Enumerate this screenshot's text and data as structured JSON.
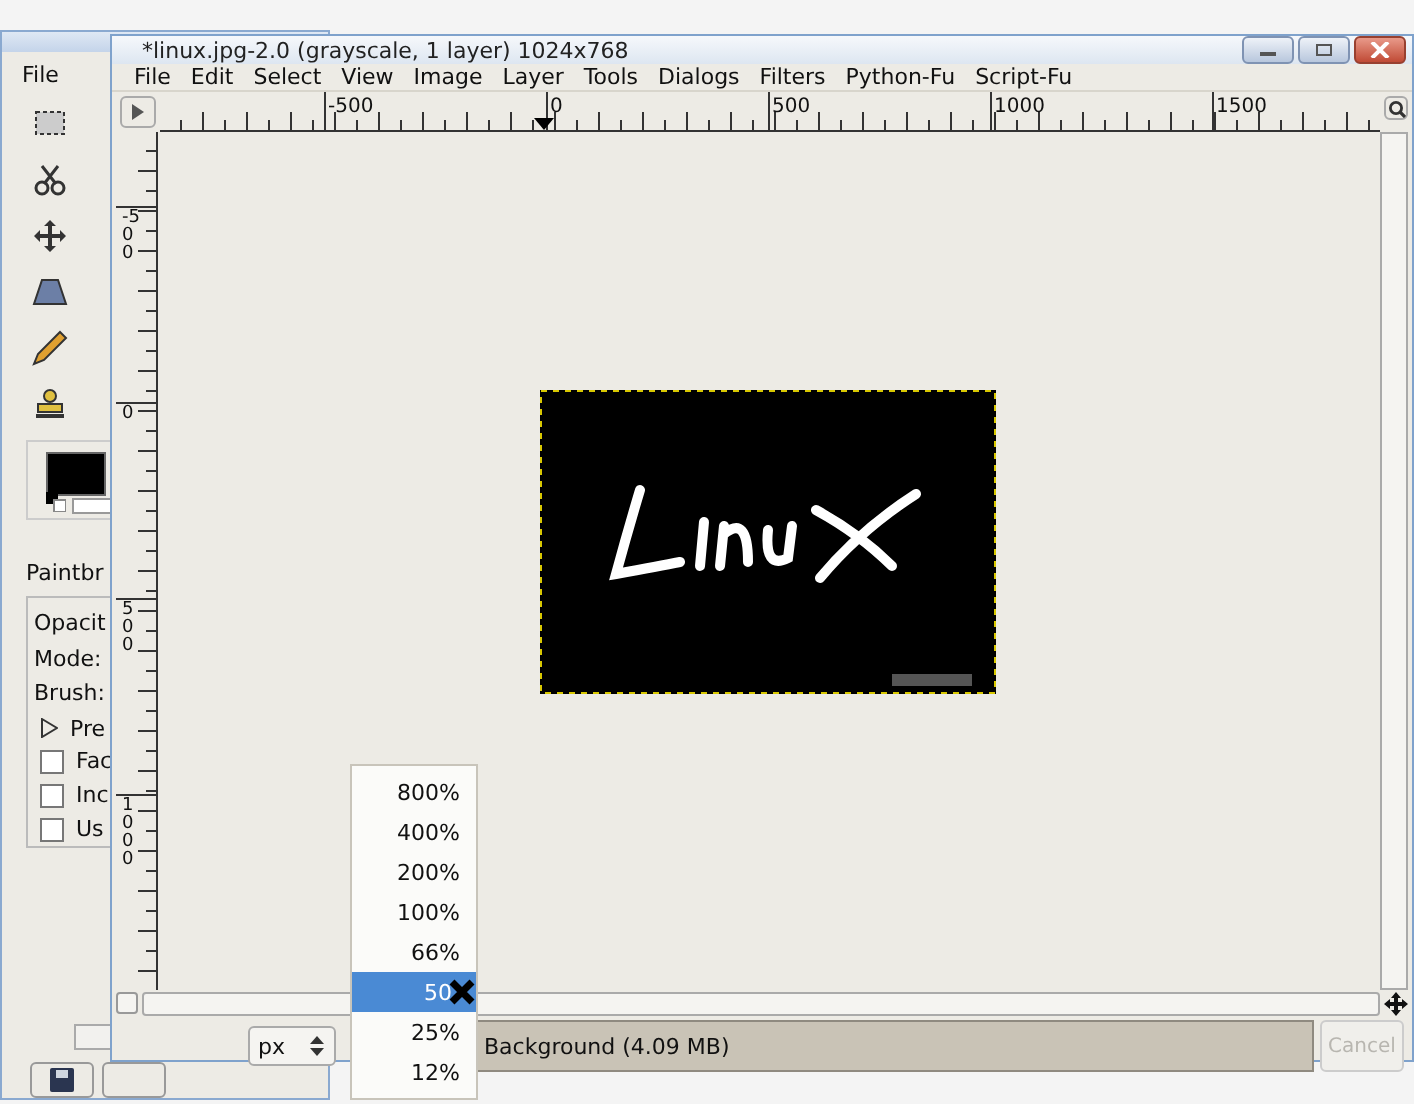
{
  "toolbox": {
    "menu": [
      "File"
    ],
    "tool_options_title": "Paintbr",
    "options": [
      {
        "kind": "label",
        "text": "Opacit"
      },
      {
        "kind": "label",
        "text": "Mode:"
      },
      {
        "kind": "label",
        "text": "Brush:"
      },
      {
        "kind": "expander",
        "text": "Pre",
        "expanded": false
      },
      {
        "kind": "checkbox",
        "text": "Fac",
        "checked": false
      },
      {
        "kind": "checkbox",
        "text": "Inc",
        "checked": false
      },
      {
        "kind": "checkbox",
        "text": "Us",
        "checked": false
      }
    ]
  },
  "image_window": {
    "title": "*linux.jpg-2.0 (grayscale, 1 layer) 1024x768",
    "menu": [
      "File",
      "Edit",
      "Select",
      "View",
      "Image",
      "Layer",
      "Tools",
      "Dialogs",
      "Filters",
      "Python-Fu",
      "Script-Fu"
    ],
    "top_ruler_labels": [
      "-500",
      "0",
      "500",
      "1000",
      "1500"
    ],
    "left_ruler_labels": [
      "-500",
      "0",
      "500",
      "1000"
    ],
    "unit": "px",
    "status": "Background (4.09 MB)",
    "cancel": {
      "label": "Cancel",
      "disabled": true
    }
  },
  "zoom_menu": [
    {
      "label": "800%",
      "selected": false
    },
    {
      "label": "400%",
      "selected": false
    },
    {
      "label": "200%",
      "selected": false
    },
    {
      "label": "100%",
      "selected": false
    },
    {
      "label": "66%",
      "selected": false
    },
    {
      "label": "50",
      "selected": true
    },
    {
      "label": "25%",
      "selected": false
    },
    {
      "label": "12%",
      "selected": false
    }
  ]
}
